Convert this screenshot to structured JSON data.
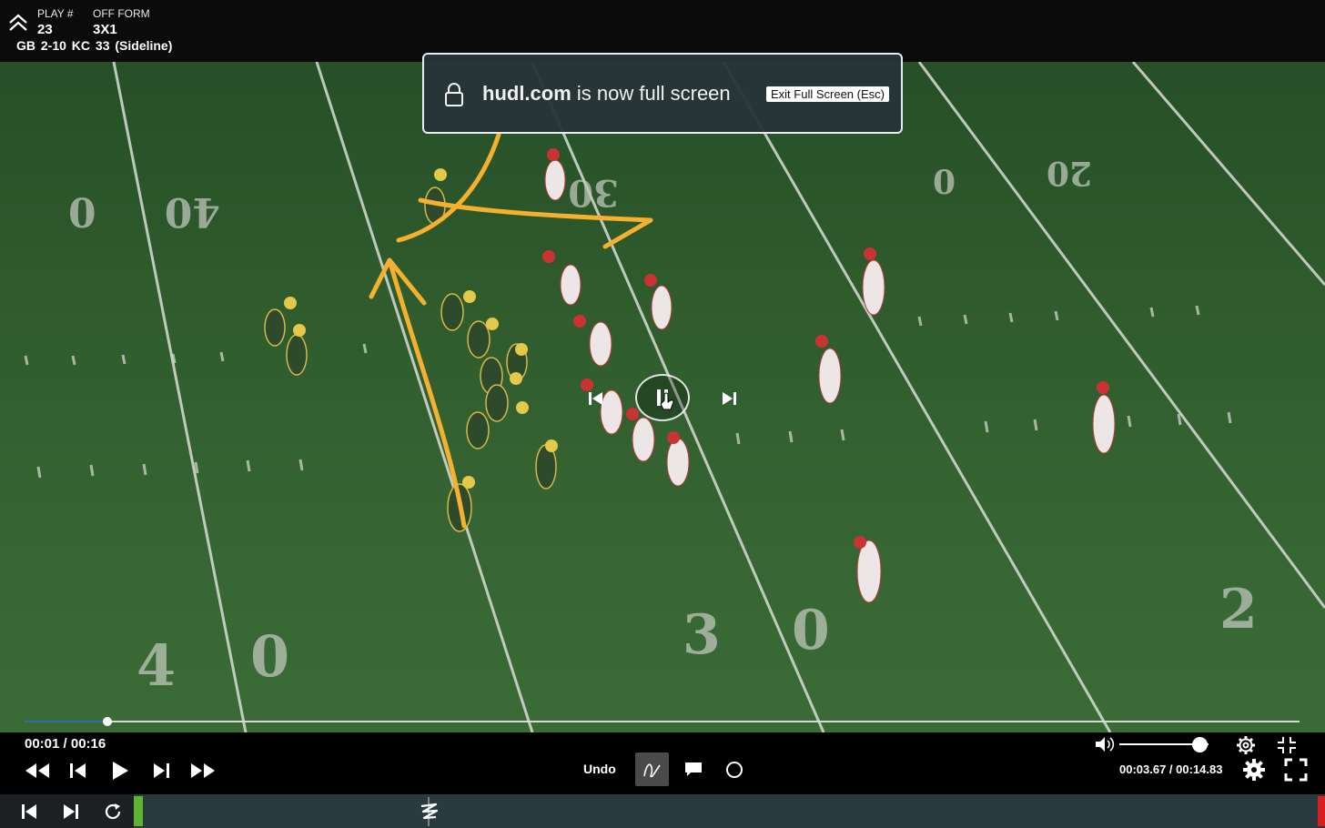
{
  "play_info": {
    "play_label": "PLAY #",
    "play_value": "23",
    "form_label": "OFF FORM",
    "form_value": "3X1",
    "situation": "GB  2-10  KC 33 (Sideline)"
  },
  "fullscreen_toast": {
    "domain": "hudl.com",
    "message": "is now full screen",
    "exit_label": "Exit Full Screen (Esc)"
  },
  "playback": {
    "elapsed": "00:01 / 00:16",
    "progress_fraction": 0.065,
    "clip_time": "00:03.67 / 00:14.83",
    "volume_fraction": 0.9
  },
  "tools": {
    "undo_label": "Undo",
    "active_tool": "freehand-draw"
  },
  "colors": {
    "annotation": "#f5b12e",
    "progress": "#2f6fb0",
    "timeline_start": "#5cb531",
    "timeline_end": "#d81e1e",
    "offense_jersey": "#2d4a2a",
    "defense_jersey": "#f0eaea"
  }
}
